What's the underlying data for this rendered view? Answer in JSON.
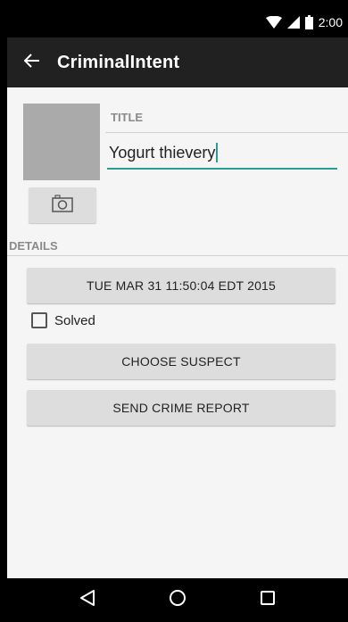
{
  "status_bar": {
    "time": "2:00",
    "icons": [
      "wifi-icon",
      "signal-icon",
      "battery-icon"
    ]
  },
  "app_bar": {
    "title": "CriminalIntent",
    "back_icon": "arrow-back-icon"
  },
  "crime": {
    "title_label": "TITLE",
    "title_value": "Yogurt thievery",
    "details_label": "DETAILS",
    "date_button_label": "TUE MAR 31 11:50:04 EDT 2015",
    "solved_label": "Solved",
    "solved_checked": false,
    "choose_suspect_label": "CHOOSE SUSPECT",
    "send_report_label": "SEND CRIME REPORT",
    "camera_icon": "camera-icon"
  },
  "nav_bar": {
    "icons": [
      "back-triangle-icon",
      "home-circle-icon",
      "recents-square-icon"
    ]
  },
  "colors": {
    "accent": "#2a9d94",
    "app_bar": "#212121",
    "background": "#f5f5f5",
    "button": "#dddddd",
    "photo_placeholder": "#aaaaaa"
  }
}
